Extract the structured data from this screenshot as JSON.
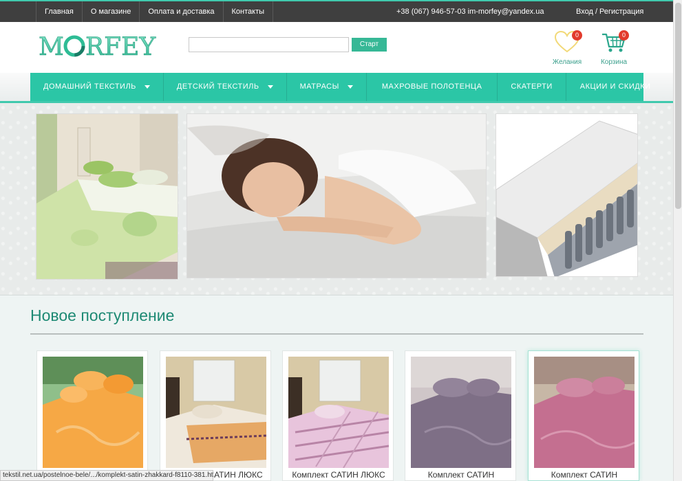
{
  "topbar": {
    "nav": [
      "Главная",
      "О магазине",
      "Оплата и доставка",
      "Контакты"
    ],
    "contacts": "+38 (067) 946-57-03 im-morfey@yandex.ua",
    "auth": "Вход / Регистрация"
  },
  "header": {
    "logo_text": "MORFEY",
    "search": {
      "value": "",
      "placeholder": ""
    },
    "search_button": "Старт",
    "wishlist": {
      "label": "Желания",
      "count": "0"
    },
    "cart": {
      "label": "Корзина",
      "count": "0"
    }
  },
  "mainnav": {
    "items": [
      {
        "label": "ДОМАШНИЙ ТЕКСТИЛЬ",
        "dropdown": true
      },
      {
        "label": "ДЕТСКИЙ ТЕКСТИЛЬ",
        "dropdown": true
      },
      {
        "label": "МАТРАСЫ",
        "dropdown": true
      },
      {
        "label": "МАХРОВЫЕ ПОЛОТЕНЦА",
        "dropdown": false
      },
      {
        "label": "СКАТЕРТИ",
        "dropdown": false
      },
      {
        "label": "АКЦИИ И СКИДКИ",
        "dropdown": false
      }
    ]
  },
  "slider": {
    "dot_count": 5,
    "active_dot": 1
  },
  "new_arrivals": {
    "title": "Новое поступление",
    "products": [
      {
        "name": ""
      },
      {
        "name": "Комплект САТИН ЛЮКС"
      },
      {
        "name": "Комплект САТИН ЛЮКС"
      },
      {
        "name": "Комплект САТИН"
      },
      {
        "name": "Комплект САТИН"
      }
    ]
  },
  "status_bar": "tekstil.net.ua/postelnoe-bele/.../komplekt-satin-zhakkard-f8110-381.html",
  "colors": {
    "accent": "#2bc6a6",
    "topbar": "#3f3f3f",
    "badge": "#e23a2c"
  }
}
